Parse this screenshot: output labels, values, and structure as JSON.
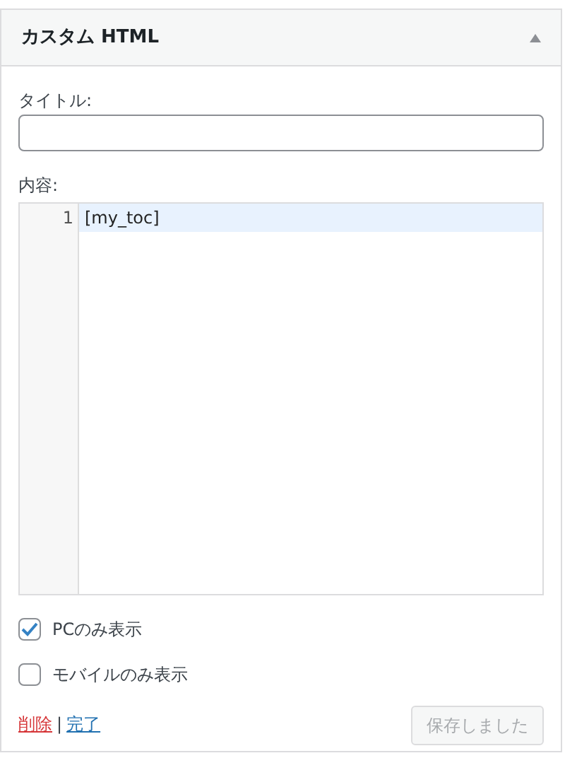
{
  "widget": {
    "title": "カスタム HTML",
    "expanded": true
  },
  "title_field": {
    "label": "タイトル:"
  },
  "content_editor": {
    "label": "内容:",
    "lines": [
      {
        "number": "1",
        "text": "[my_toc]",
        "selected": true
      }
    ]
  },
  "options": [
    {
      "label": "PCのみ表示",
      "checked": true
    },
    {
      "label": "モバイルのみ表示",
      "checked": false
    }
  ],
  "links": [
    {
      "label": "削除",
      "kind": "danger"
    },
    {
      "label": "完了",
      "kind": "normal"
    }
  ],
  "separator": "|",
  "save_button": {
    "label": "保存しました",
    "disabled": true
  }
}
